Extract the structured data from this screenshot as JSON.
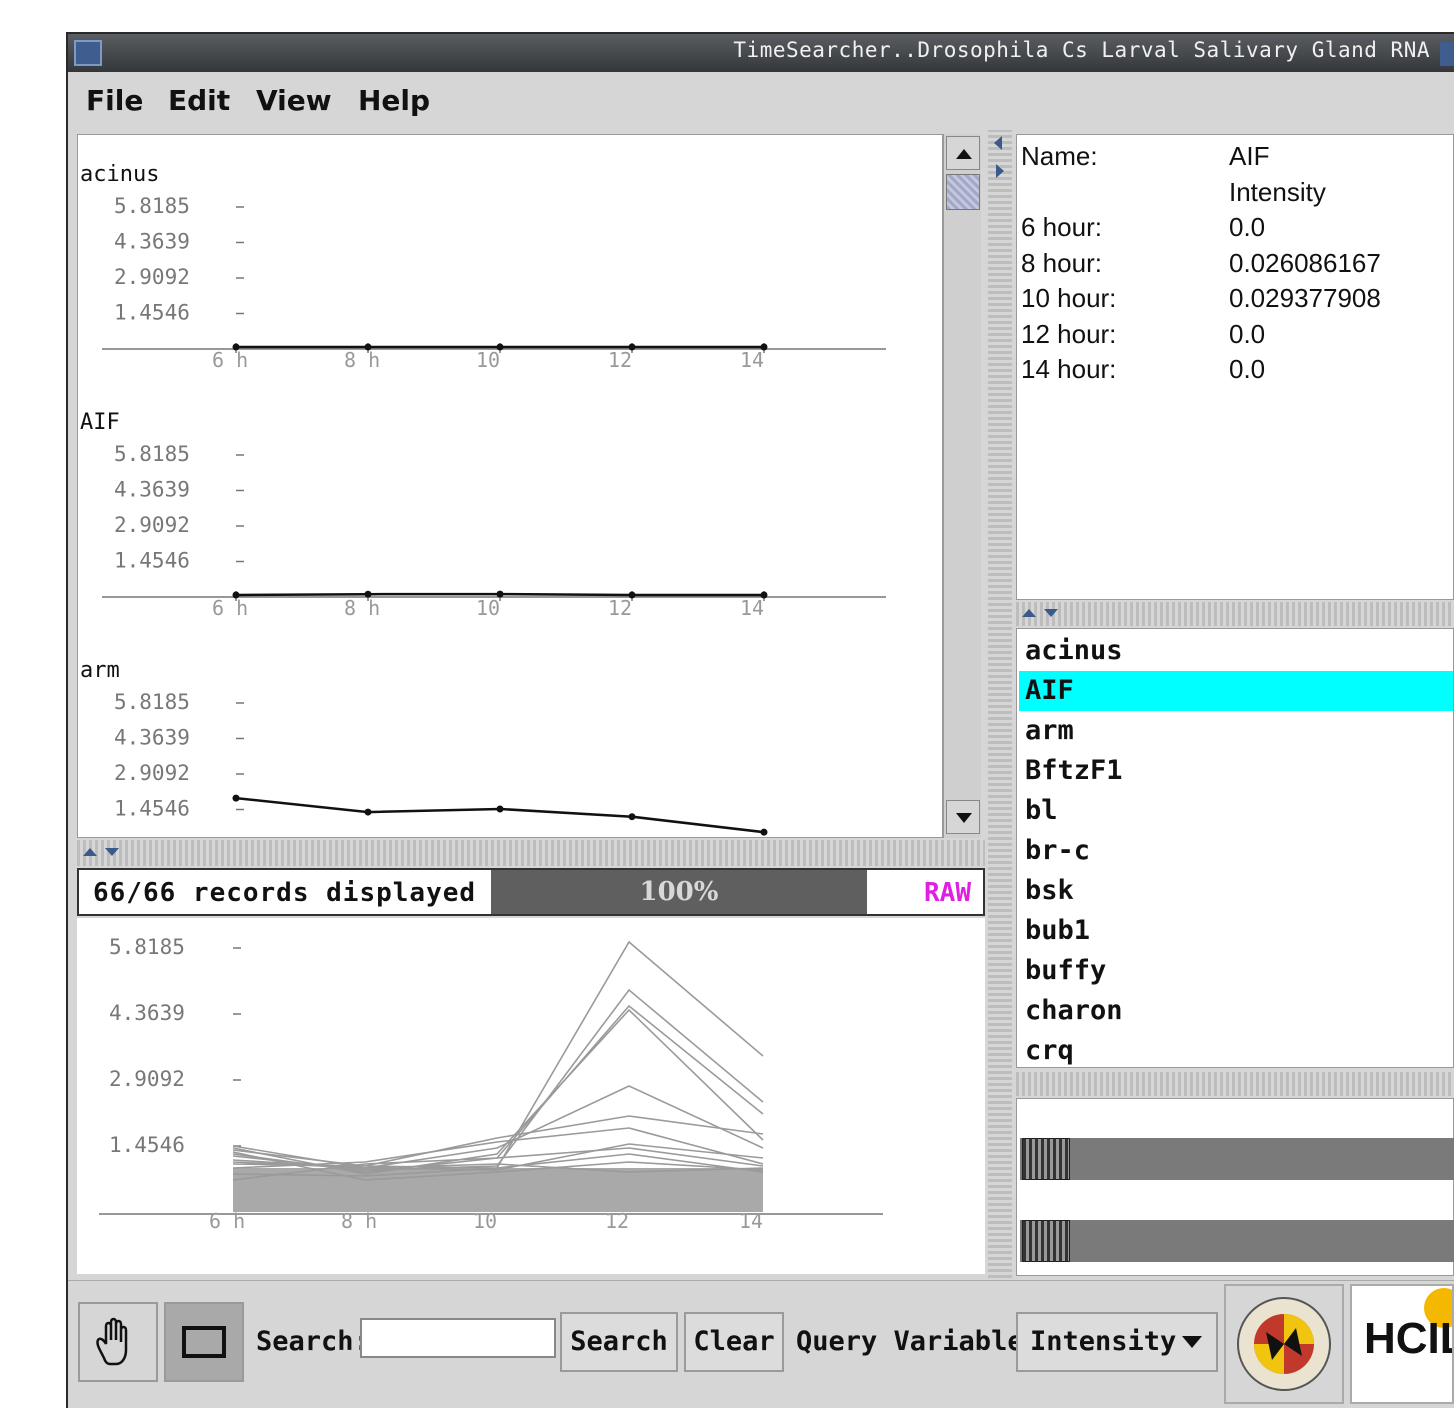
{
  "window": {
    "title": "TimeSearcher..Drosophila Cs Larval Salivary Gland RNA"
  },
  "menu": {
    "items": [
      {
        "label": "File"
      },
      {
        "label": "Edit"
      },
      {
        "label": "View"
      },
      {
        "label": "Help"
      }
    ]
  },
  "charts": [
    {
      "name": "acinus",
      "y_ticks": [
        "5.8185",
        "4.3639",
        "2.9092",
        "1.4546"
      ],
      "x_ticks": [
        "6 h",
        "8 h",
        "10",
        "12",
        "14"
      ],
      "values": [
        0.0,
        0.0,
        0.0,
        0.0,
        0.0
      ]
    },
    {
      "name": "AIF",
      "y_ticks": [
        "5.8185",
        "4.3639",
        "2.9092",
        "1.4546"
      ],
      "x_ticks": [
        "6 h",
        "8 h",
        "10",
        "12",
        "14"
      ],
      "values": [
        0.0,
        0.026086167,
        0.029377908,
        0.0,
        0.0
      ]
    },
    {
      "name": "arm",
      "y_ticks": [
        "5.8185",
        "4.3639",
        "2.9092",
        "1.4546"
      ],
      "x_ticks": [
        "6 h",
        "8 h",
        "10",
        "12",
        "14"
      ],
      "values": [
        1.45,
        1.0,
        1.1,
        0.85,
        0.35
      ]
    }
  ],
  "status": {
    "records": "66/66 records displayed",
    "percent": "100%",
    "mode": "RAW",
    "percent_value": 1.0
  },
  "overview": {
    "y_ticks": [
      "5.8185",
      "4.3639",
      "2.9092",
      "1.4546"
    ],
    "x_ticks": [
      "6 h",
      "8 h",
      "10",
      "12",
      "14"
    ]
  },
  "detail": {
    "rows": [
      {
        "label": "Name:",
        "value": "AIF"
      },
      {
        "label": "",
        "value": "Intensity"
      },
      {
        "label": "6 hour:",
        "value": "0.0"
      },
      {
        "label": "8 hour:",
        "value": "0.026086167"
      },
      {
        "label": "10 hour:",
        "value": "0.029377908"
      },
      {
        "label": "12 hour:",
        "value": "0.0"
      },
      {
        "label": "14 hour:",
        "value": "0.0"
      }
    ]
  },
  "gene_list": {
    "items": [
      "acinus",
      "AIF",
      "arm",
      "BftzF1",
      "bl",
      "br-c",
      "bsk",
      "bub1",
      "buffy",
      "charon",
      "crq"
    ],
    "selected": "AIF"
  },
  "toolbar": {
    "search_label": "Search:",
    "search_value": "",
    "search_button": "Search",
    "clear_button": "Clear",
    "query_variable_label": "Query Variable",
    "query_variable_value": "Intensity",
    "logo_text": "HCIL"
  },
  "colors": {
    "selection": "#00ffff",
    "raw_label": "#e020e0",
    "titlebar": "#3a3d41"
  }
}
